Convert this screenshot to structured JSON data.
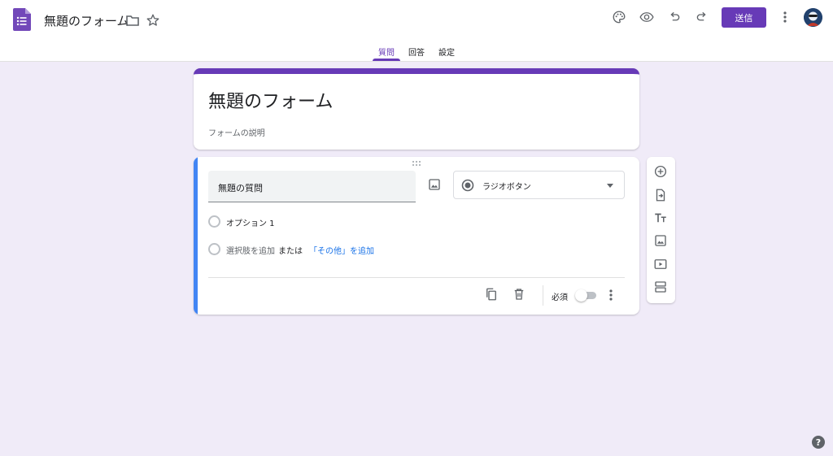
{
  "header": {
    "doc_title": "無題のフォーム",
    "send_label": "送信",
    "accent_color": "#673ab7"
  },
  "tabs": [
    {
      "label": "質問",
      "active": true
    },
    {
      "label": "回答",
      "active": false
    },
    {
      "label": "設定",
      "active": false
    }
  ],
  "form": {
    "title": "無題のフォーム",
    "description_placeholder": "フォームの説明"
  },
  "question": {
    "title": "無題の質問",
    "type_label": "ラジオボタン",
    "option_1": "オプション 1",
    "add_option": "選択肢を追加",
    "or_text": "または",
    "add_other": "「その他」を追加",
    "required_label": "必須",
    "required": false
  },
  "icons": {
    "header": [
      "form-logo-icon",
      "folder-icon",
      "star-icon",
      "palette-icon",
      "preview-eye-icon",
      "undo-icon",
      "redo-icon",
      "more-vert-icon"
    ],
    "sidebar": [
      "add-question-icon",
      "import-questions-icon",
      "add-title-icon",
      "add-image-icon",
      "add-video-icon",
      "add-section-icon"
    ]
  },
  "help_label": "?"
}
